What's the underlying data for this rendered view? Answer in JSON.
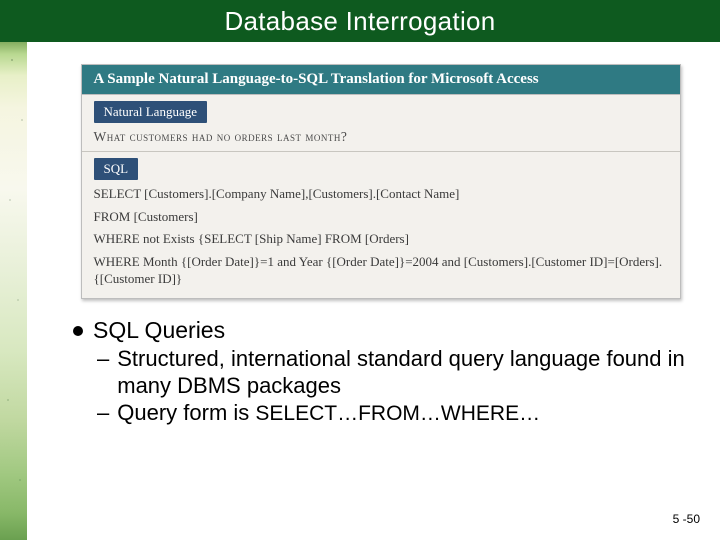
{
  "header": {
    "title": "Database Interrogation"
  },
  "figure": {
    "title": "A Sample Natural Language-to-SQL Translation for Microsoft Access",
    "nl_badge": "Natural Language",
    "nl_question": "What customers had no orders last month?",
    "sql_badge": "SQL",
    "sql_lines": [
      "SELECT [Customers].[Company Name],[Customers].[Contact Name]",
      "FROM [Customers]",
      "WHERE not Exists {SELECT [Ship Name] FROM [Orders]",
      "WHERE Month {[Order Date]}=1 and Year {[Order Date]}=2004 and [Customers].[Customer ID]=[Orders].{[Customer ID]}"
    ]
  },
  "bullets": {
    "heading": "SQL Queries",
    "sub1": "Structured, international standard query language found in many DBMS packages",
    "sub2_pre": "Query form is ",
    "sub2_sc": "SELECT…FROM…WHERE…"
  },
  "page_number": "5 -50"
}
